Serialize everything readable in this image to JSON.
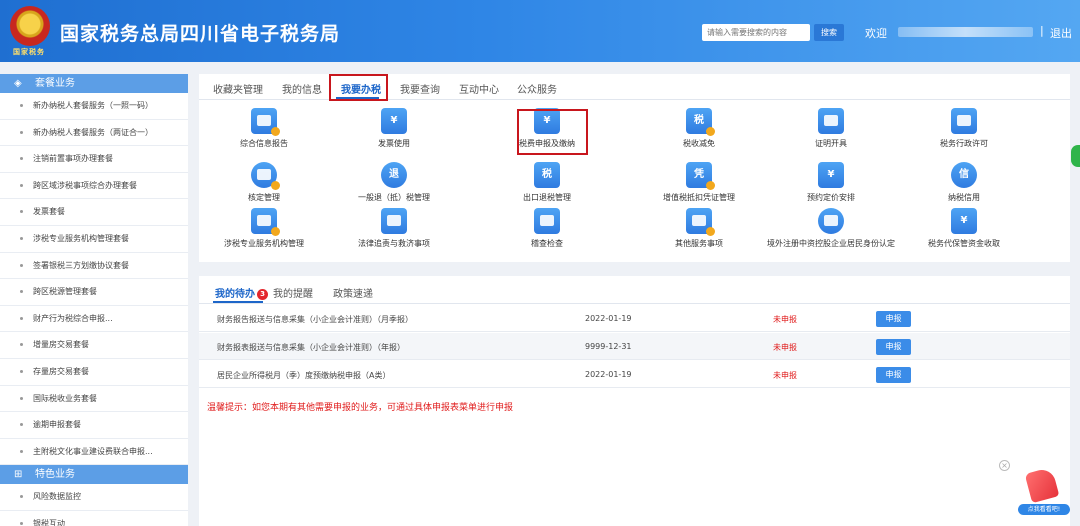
{
  "header": {
    "emblem_text": "国家税务",
    "title": "国家税务总局四川省电子税务局",
    "search_placeholder": "请输入需要搜索的内容",
    "search_button": "搜索",
    "welcome": "欢迎",
    "separator": "|",
    "logout": "退出"
  },
  "sidebar": {
    "category_1": "套餐业务",
    "items_1": [
      "新办纳税人套餐服务（一照一码）",
      "新办纳税人套餐服务（两证合一）",
      "注销前置事项办理套餐",
      "跨区域涉税事项综合办理套餐",
      "发票套餐",
      "涉税专业服务机构管理套餐",
      "签署银税三方划缴协议套餐",
      "跨区税源管理套餐",
      "财产行为税综合申报...",
      "增量房交易套餐",
      "存量房交易套餐",
      "国际税收业务套餐",
      "逾期申报套餐",
      "主附税文化事业建设费联合申报..."
    ],
    "category_2": "特色业务",
    "items_2": [
      "风险数据监控",
      "银税互动"
    ]
  },
  "top_tabs": [
    "收藏夹管理",
    "我的信息",
    "我要办税",
    "我要查询",
    "互动中心",
    "公众服务"
  ],
  "services": [
    {
      "label": "综合信息报告",
      "icon": "report-icon",
      "glyph": ""
    },
    {
      "label": "发票使用",
      "icon": "invoice-icon",
      "glyph": "¥"
    },
    {
      "label": "税费申报及缴纳",
      "icon": "hand-coin-icon",
      "glyph": "¥"
    },
    {
      "label": "税收减免",
      "icon": "tax-reduction-icon",
      "glyph": "税"
    },
    {
      "label": "证明开具",
      "icon": "certificate-icon",
      "glyph": ""
    },
    {
      "label": "税务行政许可",
      "icon": "license-icon",
      "glyph": ""
    },
    {
      "label": "核定管理",
      "icon": "approval-icon",
      "glyph": ""
    },
    {
      "label": "一般退（抵）税管理",
      "icon": "refund-icon",
      "glyph": "退"
    },
    {
      "label": "出口退税管理",
      "icon": "export-refund-icon",
      "glyph": "税"
    },
    {
      "label": "增值税抵扣凭证管理",
      "icon": "vat-voucher-icon",
      "glyph": "凭"
    },
    {
      "label": "预约定价安排",
      "icon": "pricing-icon",
      "glyph": "¥"
    },
    {
      "label": "纳税信用",
      "icon": "credit-icon",
      "glyph": "信"
    },
    {
      "label": "涉税专业服务机构管理",
      "icon": "agency-building-icon",
      "glyph": ""
    },
    {
      "label": "法律追责与救济事项",
      "icon": "gavel-icon",
      "glyph": ""
    },
    {
      "label": "稽查检查",
      "icon": "inspection-icon",
      "glyph": ""
    },
    {
      "label": "其他服务事项",
      "icon": "heart-service-icon",
      "glyph": ""
    },
    {
      "label": "境外注册中资控股企业居民身份认定",
      "icon": "person-icon",
      "glyph": ""
    },
    {
      "label": "税务代保管资金收取",
      "icon": "fund-custody-icon",
      "glyph": "¥"
    }
  ],
  "bottom_tabs": {
    "todo": "我的待办",
    "todo_count": "3",
    "reminders": "我的提醒",
    "policy": "政策速递"
  },
  "todo_rows": [
    {
      "name": "财务报告报送与信息采集（小企业会计准则）（月季报）",
      "date": "2022-01-19",
      "status": "未申报",
      "action": "申报"
    },
    {
      "name": "财务报表报送与信息采集（小企业会计准则）（年报）",
      "date": "9999-12-31",
      "status": "未申报",
      "action": "申报"
    },
    {
      "name": "居民企业所得税月（季）度预缴纳税申报（A类）",
      "date": "2022-01-19",
      "status": "未申报",
      "action": "申报"
    }
  ],
  "tip": "温馨提示：如您本期有其他需要申报的业务，可通过具体申报表菜单进行申报",
  "float_widget": {
    "label": "点我看看吧!",
    "close": "×"
  },
  "colors": {
    "primary": "#1d66c9",
    "header_start": "#1f6fd1",
    "alert": "#e01b1b",
    "highlight_border": "#c8161d",
    "sidebar_cat": "#5c9ee6"
  }
}
